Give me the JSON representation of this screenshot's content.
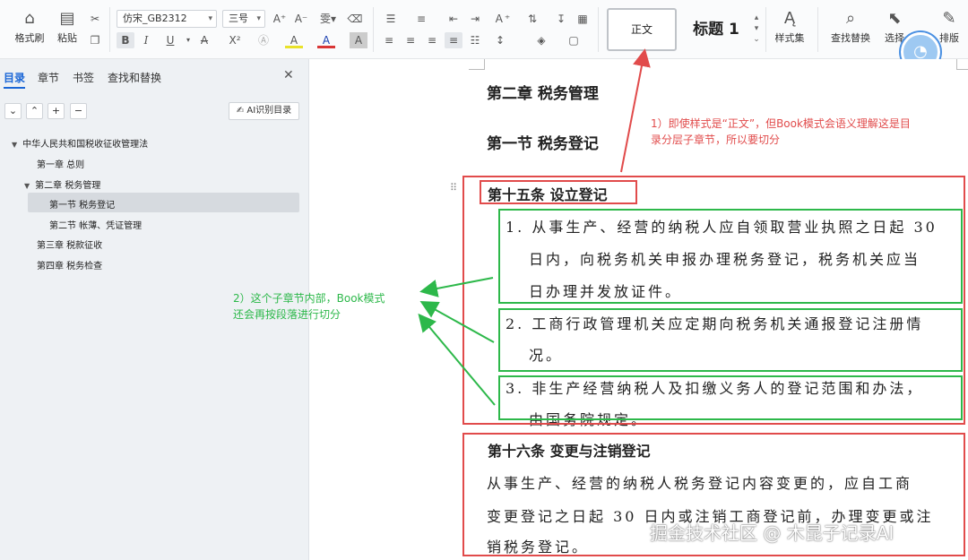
{
  "toolbar": {
    "format_painter": "格式刷",
    "paste": "粘贴",
    "font_name": "仿宋_GB2312",
    "font_size": "三号",
    "style_normal": "正文",
    "style_h1": "标题 1",
    "styles_set": "样式集",
    "find_replace": "查找替换",
    "select": "选择",
    "layout": "排版",
    "icons": {
      "bold": "B",
      "italic": "I",
      "underline": "U",
      "strike": "A",
      "superscript": "X²",
      "font_color": "A",
      "highlight": "A"
    }
  },
  "sidebar": {
    "tabs": [
      "目录",
      "章节",
      "书签",
      "查找和替换"
    ],
    "active_tab": "目录",
    "ai_button": "AI识别目录",
    "tree": [
      {
        "label": "中华人民共和国税收征收管理法",
        "level": 0,
        "expanded": true
      },
      {
        "label": "第一章 总则",
        "level": 1
      },
      {
        "label": "第二章 税务管理",
        "level": 1,
        "expanded": true
      },
      {
        "label": "第一节 税务登记",
        "level": 2,
        "selected": true
      },
      {
        "label": "第二节 帐薄、凭证管理",
        "level": 2
      },
      {
        "label": "第三章 税款征收",
        "level": 1
      },
      {
        "label": "第四章 税务检查",
        "level": 1
      }
    ]
  },
  "document": {
    "chapter": "第二章 税务管理",
    "section": "第一节 税务登记",
    "article15_title": "第十五条 设立登记",
    "item1_line1": "1. 从事生产、经营的纳税人应自领取营业执照之日起 30",
    "item1_line2": "日内，向税务机关申报办理税务登记，税务机关应当",
    "item1_line3": "日办理并发放证件。",
    "item2_line1": "2. 工商行政管理机关应定期向税务机关通报登记注册情",
    "item2_line2": "况。",
    "item3_line1": "3. 非生产经营纳税人及扣缴义务人的登记范围和办法，",
    "item3_line2": "由国务院规定。",
    "article16_title": "第十六条 变更与注销登记",
    "art16_line1": "从事生产、经营的纳税人税务登记内容变更的，应自工商",
    "art16_line2": "变更登记之日起 30 日内或注销工商登记前，办理变更或注",
    "art16_line3": "销税务登记。"
  },
  "annotations": {
    "red_line1": "1）即使样式是“正文”，但Book模式会语义理解这是目",
    "red_line2": "录分层子章节，所以要切分",
    "green_line1": "2）这个子章节内部，Book模式",
    "green_line2": "还会再按段落进行切分",
    "red_color": "#e14b4b",
    "green_color": "#2db84a"
  },
  "watermark": "掘金技术社区 @ 木昆子记录AI"
}
